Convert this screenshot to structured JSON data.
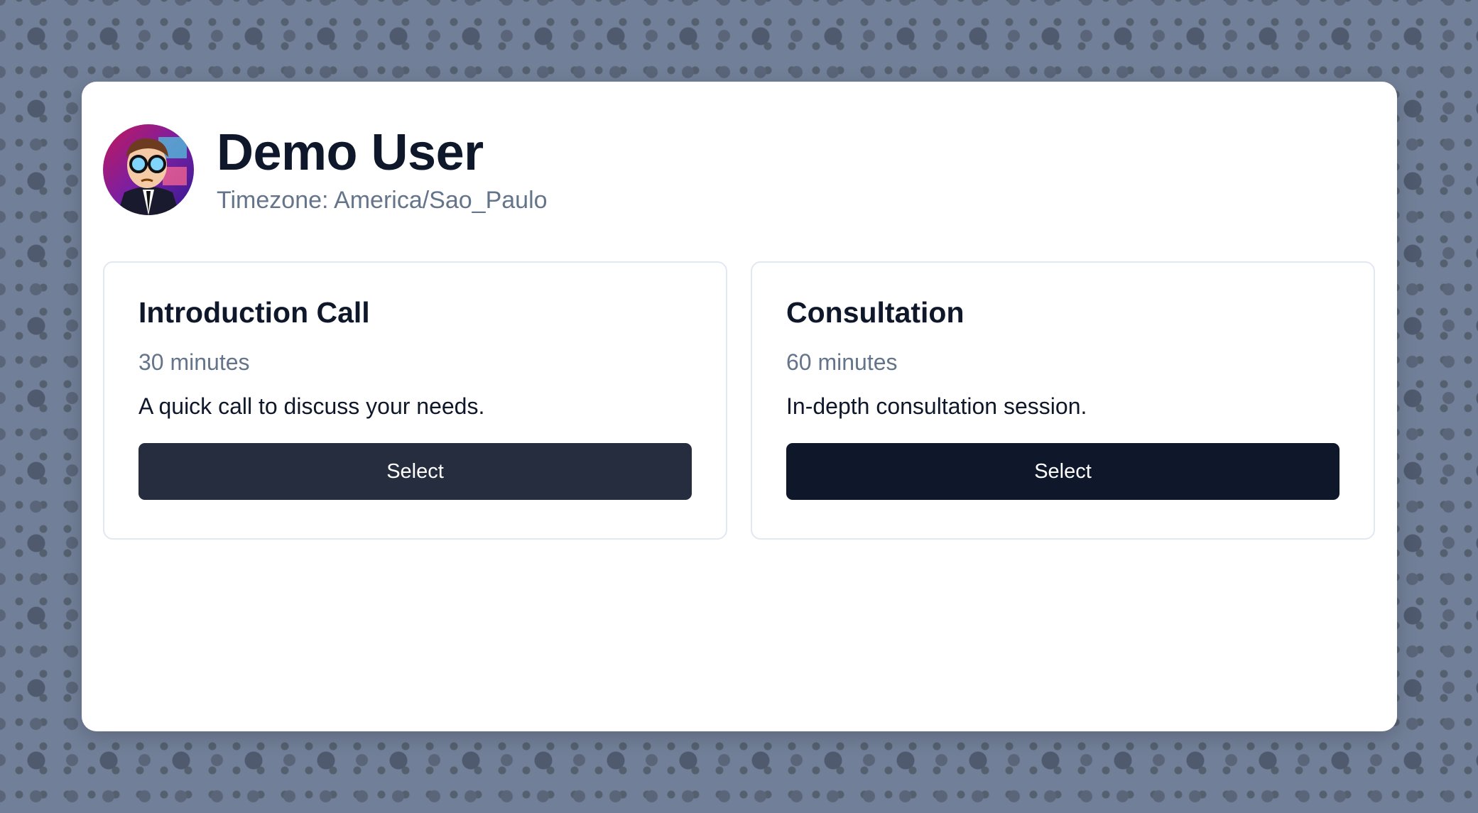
{
  "profile": {
    "name": "Demo User",
    "timezone": "Timezone: America/Sao_Paulo",
    "avatar_icon": "cartoon-avatar-icon"
  },
  "events": [
    {
      "title": "Introduction Call",
      "duration": "30 minutes",
      "description": "A quick call to discuss your needs.",
      "button_label": "Select"
    },
    {
      "title": "Consultation",
      "duration": "60 minutes",
      "description": "In-depth consultation session.",
      "button_label": "Select"
    }
  ],
  "colors": {
    "background": "#717f98",
    "card": "#ffffff",
    "primary_button": "#0f172a",
    "primary_button_hover": "#252d3f",
    "muted_text": "#64748b",
    "heading_text": "#0f172a"
  }
}
